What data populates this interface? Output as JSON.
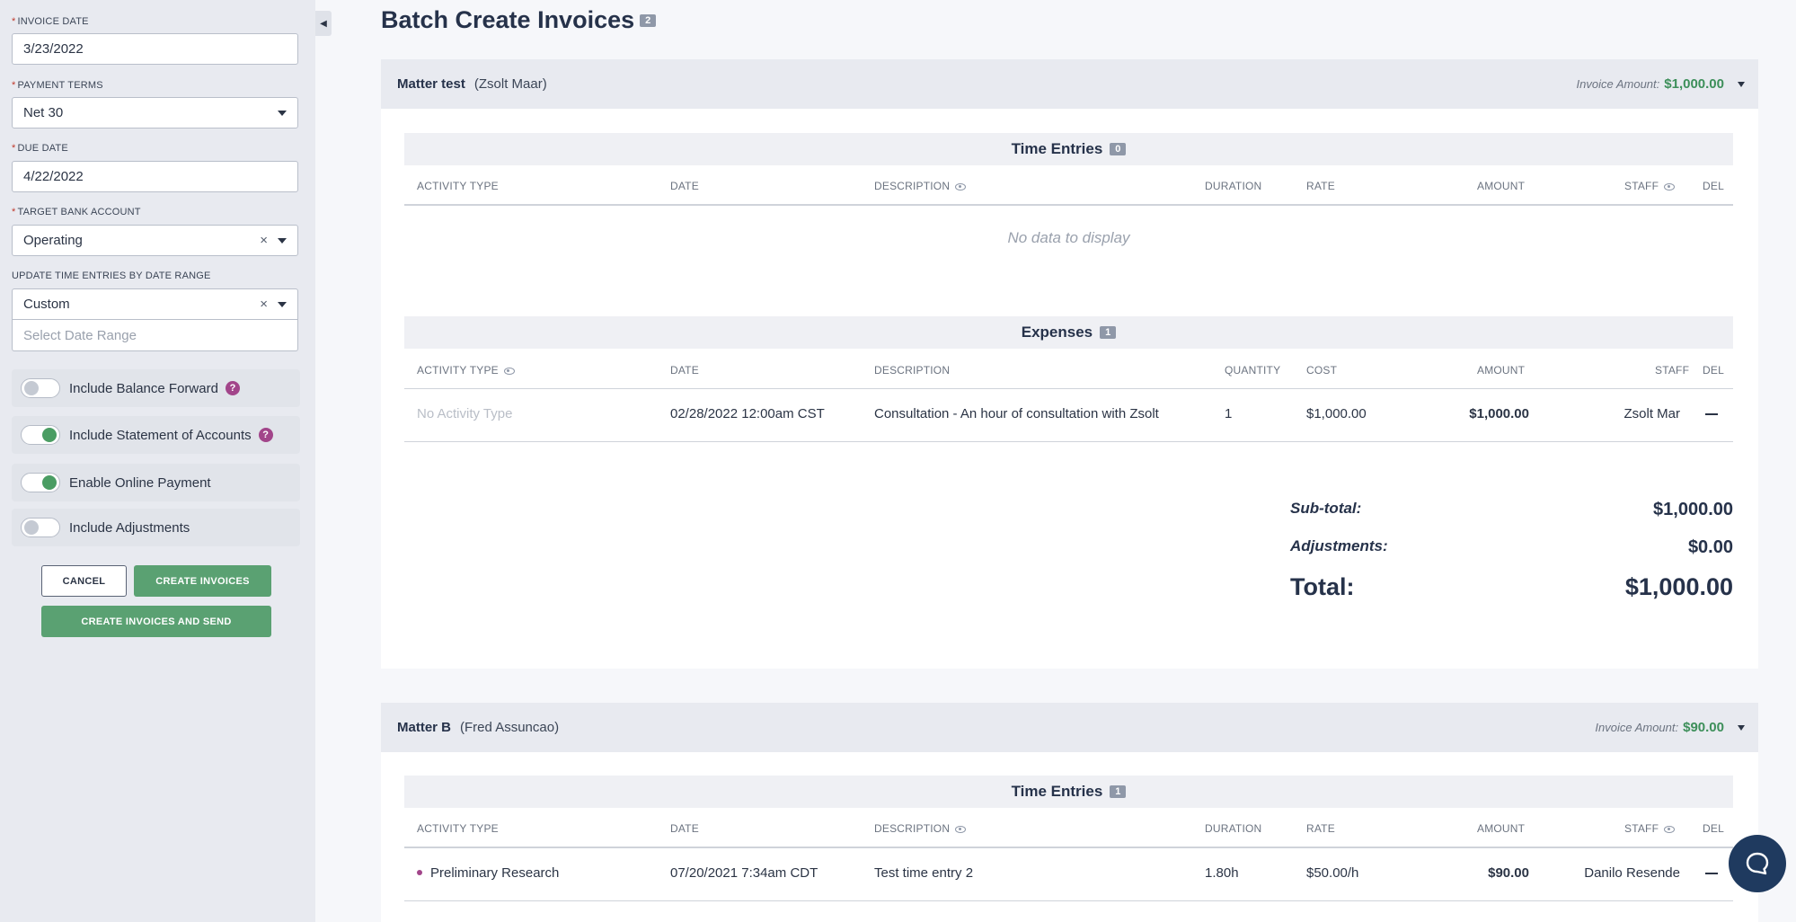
{
  "sidebar": {
    "invoice_date": {
      "label": "Invoice Date",
      "value": "3/23/2022"
    },
    "payment_terms": {
      "label": "Payment Terms",
      "value": "Net 30"
    },
    "due_date": {
      "label": "Due Date",
      "value": "4/22/2022"
    },
    "target_bank_account": {
      "label": "Target Bank Account",
      "value": "Operating"
    },
    "update_range": {
      "label": "Update Time Entries by Date Range",
      "value": "Custom",
      "date_placeholder": "Select Date Range"
    },
    "toggles": [
      {
        "label": "Include Balance Forward",
        "on": false,
        "help": true
      },
      {
        "label": "Include Statement of Accounts",
        "on": true,
        "help": true
      },
      {
        "label": "Enable Online Payment",
        "on": true,
        "help": false
      },
      {
        "label": "Include Adjustments",
        "on": false,
        "help": false
      }
    ],
    "cancel_label": "CANCEL",
    "create_label": "CREATE INVOICES",
    "create_send_label": "CREATE INVOICES AND SEND",
    "clear_symbol": "×",
    "help_symbol": "?",
    "collapse_symbol": "◀"
  },
  "page": {
    "title": "Batch Create Invoices",
    "count": "2"
  },
  "matters": [
    {
      "name": "Matter test",
      "client": "(Zsolt Maar)",
      "invoice_amount_label": "Invoice Amount:",
      "invoice_amount": "$1,000.00",
      "time_entries": {
        "title": "Time Entries",
        "count": "0",
        "headers": [
          "ACTIVITY TYPE",
          "DATE",
          "DESCRIPTION",
          "DURATION",
          "RATE",
          "AMOUNT",
          "STAFF",
          "DEL"
        ],
        "empty_text": "No data to display"
      },
      "expenses": {
        "title": "Expenses",
        "count": "1",
        "headers": [
          "ACTIVITY TYPE",
          "DATE",
          "DESCRIPTION",
          "QUANTITY",
          "COST",
          "AMOUNT",
          "STAFF",
          "DEL"
        ],
        "rows": [
          {
            "activity_type": "No Activity Type",
            "date": "02/28/2022 12:00am CST",
            "description": "Consultation - An hour of consultation with Zsolt",
            "quantity": "1",
            "cost": "$1,000.00",
            "amount": "$1,000.00",
            "staff": "Zsolt Mar"
          }
        ]
      },
      "totals": {
        "subtotal_label": "Sub-total:",
        "subtotal": "$1,000.00",
        "adjustments_label": "Adjustments:",
        "adjustments": "$0.00",
        "total_label": "Total:",
        "total": "$1,000.00"
      }
    },
    {
      "name": "Matter B",
      "client": "(Fred Assuncao)",
      "invoice_amount_label": "Invoice Amount:",
      "invoice_amount": "$90.00",
      "time_entries": {
        "title": "Time Entries",
        "count": "1",
        "headers": [
          "ACTIVITY TYPE",
          "DATE",
          "DESCRIPTION",
          "DURATION",
          "RATE",
          "AMOUNT",
          "STAFF",
          "DEL"
        ],
        "rows": [
          {
            "activity_type": "Preliminary Research",
            "date": "07/20/2021 7:34am CDT",
            "description": "Test time entry 2",
            "duration": "1.80h",
            "rate": "$50.00/h",
            "amount": "$90.00",
            "staff": "Danilo Resende"
          }
        ]
      }
    }
  ],
  "colors": {
    "accent_green": "#5aa172",
    "amount_green": "#3d8f5a",
    "help_purple": "#a2458a",
    "chat_navy": "#1f3a5f"
  }
}
